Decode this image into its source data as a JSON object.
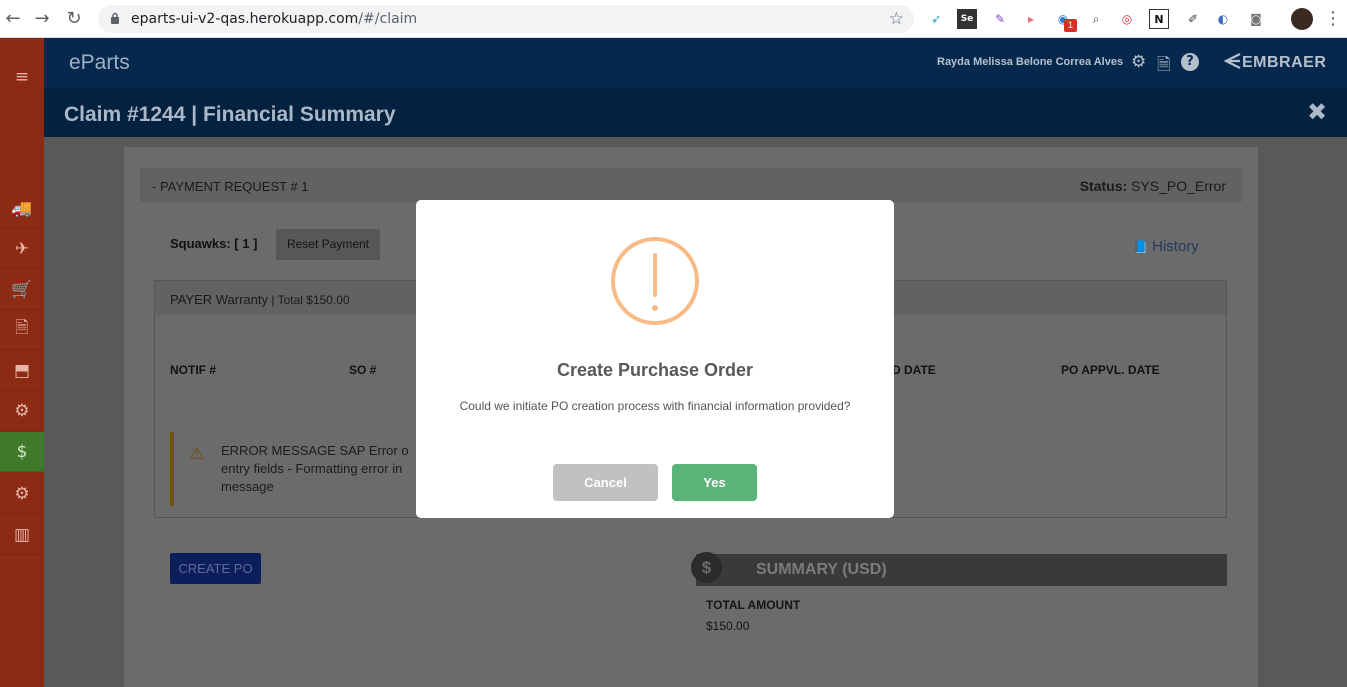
{
  "browser": {
    "url_host": "eparts-ui-v2-qas.herokuapp.com",
    "url_path": "/#/claim",
    "back_icon": "←",
    "forward_icon": "→",
    "reload_icon": "↻",
    "star_icon": "☆",
    "extension_badge": "1",
    "menu_icon": "⋮"
  },
  "header": {
    "brand": "eParts",
    "user_name": "Rayda Melissa Belone Correa Alves",
    "logo_text": "EMBRAER",
    "settings_icon": "⚙",
    "document_icon": "🗎",
    "help_icon": "?"
  },
  "sidebar": {
    "items": [
      {
        "icon": "≡",
        "name": "menu"
      },
      {
        "icon": "🚚",
        "name": "truck"
      },
      {
        "icon": "✈",
        "name": "airplane"
      },
      {
        "icon": "🛒",
        "name": "cart"
      },
      {
        "icon": "🗎",
        "name": "document"
      },
      {
        "icon": "⬒",
        "name": "box-return"
      },
      {
        "icon": "⚙",
        "name": "exchange-gears"
      },
      {
        "icon": "$",
        "name": "financial"
      },
      {
        "icon": "⚙",
        "name": "settings"
      },
      {
        "icon": "▥",
        "name": "chart"
      }
    ]
  },
  "page": {
    "title": "Claim #1244 | Financial Summary",
    "close_icon": "✖"
  },
  "payment_request": {
    "title": "- PAYMENT REQUEST # 1",
    "status_label": "Status:",
    "status_value": "SYS_PO_Error",
    "squawks": "Squawks: [ 1 ]",
    "reset_button": "Reset Payment",
    "history_icon": "📘",
    "history_label": "History"
  },
  "payer": {
    "title": "PAYER Warranty",
    "total": " | Total $150.00",
    "columns": [
      "NOTIF #",
      "SO #",
      "D DATE",
      "PO APPVL. DATE"
    ],
    "error_icon": "⚠",
    "error_message": "ERROR MESSAGE SAP Error o entry fields - Formatting error in message"
  },
  "actions": {
    "create_po": "CREATE PO"
  },
  "summary": {
    "coin": "$",
    "title": "SUMMARY (USD)",
    "total_label": "TOTAL AMOUNT",
    "total_value": "$150.00"
  },
  "modal": {
    "title": "Create Purchase Order",
    "text": "Could we initiate PO creation process with financial information provided?",
    "cancel": "Cancel",
    "confirm": "Yes"
  }
}
